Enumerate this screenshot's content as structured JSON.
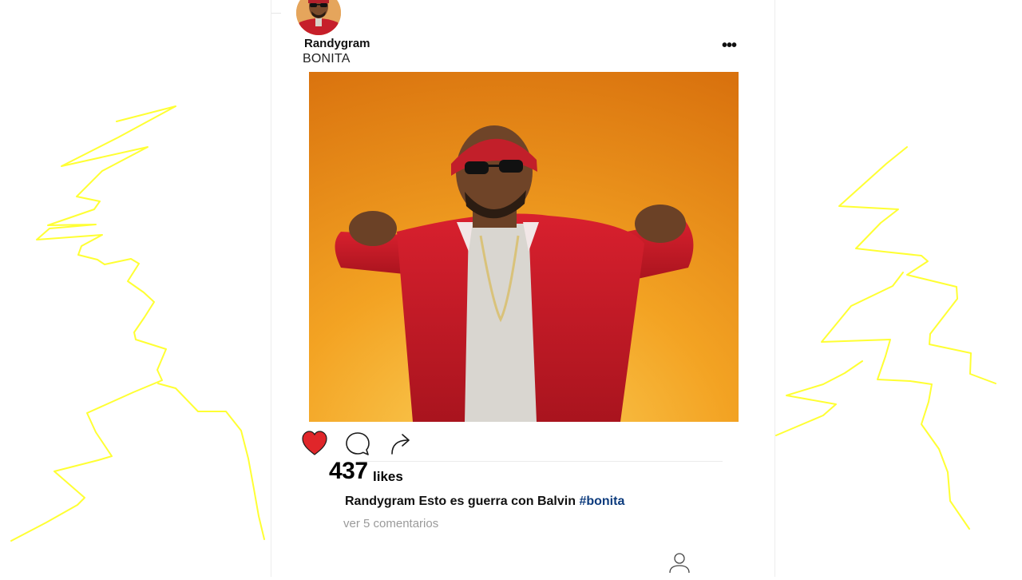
{
  "post": {
    "username": "Randygram",
    "subtitle": "BONITA",
    "more_icon": "more-dots-icon",
    "more_label": "•••",
    "likes_count": "437",
    "likes_label": "likes",
    "caption_user": "Randygram",
    "caption_text": "Esto es guerra con Balvin",
    "caption_hashtag": "#bonita",
    "view_comments": "ver 5 comentarios",
    "liked": true
  },
  "icons": {
    "like": "heart-icon",
    "comment": "comment-icon",
    "share": "share-icon",
    "profile": "profile-icon"
  },
  "colors": {
    "heart": "#e0262a",
    "hashtag": "#0c3b7d",
    "scribble": "#ffff33",
    "photo_background": "#f29a14"
  }
}
